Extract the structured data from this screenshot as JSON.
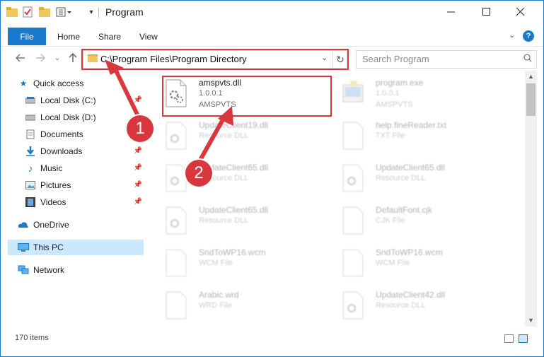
{
  "window": {
    "title": "Program"
  },
  "ribbon": {
    "file": "File",
    "home": "Home",
    "share": "Share",
    "view": "View",
    "help": "?"
  },
  "nav": {
    "address": "C:\\Program Files\\Program Directory",
    "search_placeholder": "Search Program"
  },
  "sidebar": {
    "items": [
      {
        "label": "Quick access",
        "icon": "star-icon"
      },
      {
        "label": "Local Disk (C:)",
        "icon": "disk-icon"
      },
      {
        "label": "Local Disk (D:)",
        "icon": "disk-icon"
      },
      {
        "label": "Documents",
        "icon": "documents-icon"
      },
      {
        "label": "Downloads",
        "icon": "download-icon"
      },
      {
        "label": "Music",
        "icon": "music-icon"
      },
      {
        "label": "Pictures",
        "icon": "pictures-icon"
      },
      {
        "label": "Videos",
        "icon": "videos-icon"
      },
      {
        "label": "OneDrive",
        "icon": "cloud-icon"
      },
      {
        "label": "This PC",
        "icon": "pc-icon"
      },
      {
        "label": "Network",
        "icon": "network-icon"
      }
    ]
  },
  "files": [
    {
      "name": "amspvts.dll",
      "sub1": "1.0.0.1",
      "sub2": "AMSPVTS"
    },
    {
      "name": "program.exe",
      "sub1": "1.0.0.1",
      "sub2": "AMSPVTS"
    },
    {
      "name": "UpdateClient19.dll",
      "sub1": "Resource DLL",
      "sub2": ""
    },
    {
      "name": "help.fineReader.txt",
      "sub1": "TXT File",
      "sub2": ""
    },
    {
      "name": "UpdateClient65.dll",
      "sub1": "Resource DLL",
      "sub2": ""
    },
    {
      "name": "UpdateClient65.dll",
      "sub1": "Resource DLL",
      "sub2": ""
    },
    {
      "name": "UpdateClient65.dll",
      "sub1": "Resource DLL",
      "sub2": ""
    },
    {
      "name": "DefaultFont.cjk",
      "sub1": "CJK File",
      "sub2": ""
    },
    {
      "name": "SndToWP16.wcm",
      "sub1": "WCM File",
      "sub2": ""
    },
    {
      "name": "SndToWP16.wcm",
      "sub1": "WCM File",
      "sub2": ""
    },
    {
      "name": "Arabic.wrd",
      "sub1": "WRD File",
      "sub2": ""
    },
    {
      "name": "UpdateClient42.dll",
      "sub1": "Resource DLL",
      "sub2": ""
    }
  ],
  "status": {
    "count": "170 items"
  },
  "annotations": {
    "step1": "1",
    "step2": "2",
    "highlight_color": "#d9373e"
  },
  "colors": {
    "accent": "#1979ca",
    "selected": "#cce8ff"
  }
}
